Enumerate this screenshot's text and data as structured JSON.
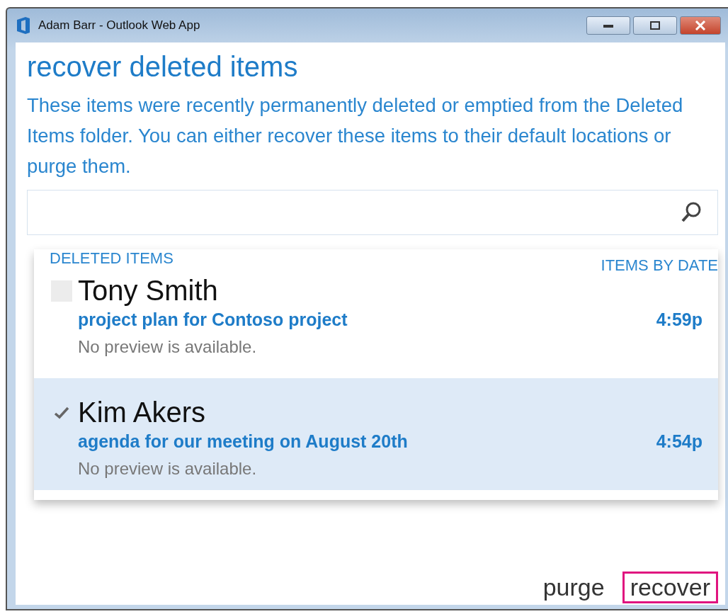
{
  "window": {
    "title": "Adam Barr - Outlook Web App"
  },
  "heading": "recover deleted items",
  "description": "These items were recently permanently deleted or emptied from the Deleted Items folder. You can either recover these items to their default locations or purge them.",
  "list": {
    "label": "DELETED ITEMS",
    "sort": "ITEMS BY DATE",
    "items": [
      {
        "sender": "Tony Smith",
        "subject": "project plan for Contoso project",
        "time": "4:59p",
        "preview": "No preview is available.",
        "checked": false,
        "selected": false
      },
      {
        "sender": "Kim Akers",
        "subject": "agenda for our meeting on August 20th",
        "time": "4:54p",
        "preview": "No preview is available.",
        "checked": true,
        "selected": true
      }
    ]
  },
  "actions": [
    {
      "label": "purge",
      "highlighted": false
    },
    {
      "label": "recover",
      "highlighted": true
    }
  ]
}
